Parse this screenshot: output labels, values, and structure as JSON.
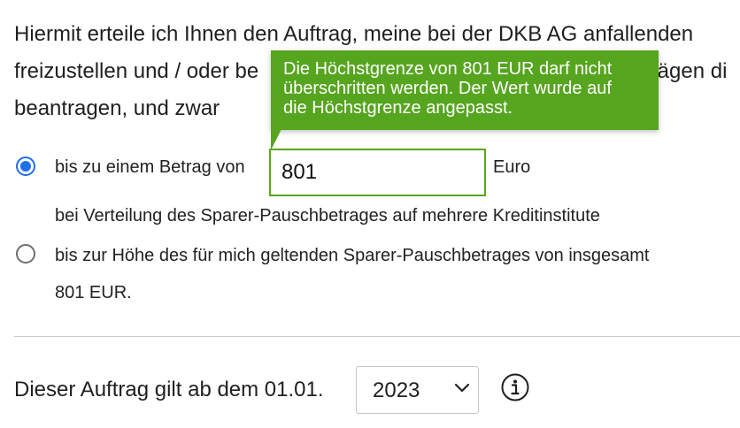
{
  "intro": {
    "line1": "Hiermit erteile ich Ihnen den Auftrag, meine bei der DKB AG anfallenden",
    "line2": "freizustellen und / oder be",
    "line2_tail": "trägen di",
    "line3": "beantragen, und zwar"
  },
  "tooltip": {
    "line1": "Die Höchstgrenze von 801 EUR darf nicht",
    "line2": "überschritten werden. Der Wert wurde auf",
    "line3": "die Höchstgrenze angepasst.",
    "color": "#56a51f"
  },
  "option_amount": {
    "label": "bis zu einem Betrag von",
    "input_value": "801",
    "unit": "Euro",
    "sublabel": "bei Verteilung des Sparer-Pauschbetrages auf mehrere Kreditinstitute",
    "selected": true
  },
  "option_full": {
    "label_line1": "bis zur Höhe des für mich geltenden Sparer-Pauschbetrages von insgesamt",
    "label_line2": "801 EUR.",
    "selected": false
  },
  "validity": {
    "label": "Dieser Auftrag gilt ab dem 01.01.",
    "year": "2023"
  },
  "icons": {
    "info": "info-icon",
    "dropdown": "chevron-down-icon"
  },
  "colors": {
    "radio_selected": "#1f70e8",
    "input_border_valid": "#5aa61a"
  }
}
